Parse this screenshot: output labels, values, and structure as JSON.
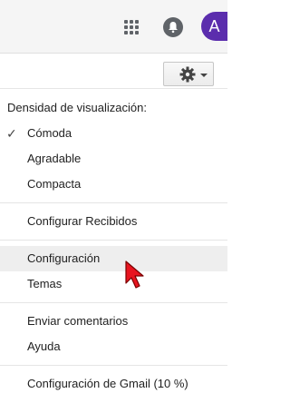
{
  "topbar": {
    "apps_icon": "apps-grid-icon",
    "notifications_icon": "bell-icon",
    "avatar_initial": "A",
    "avatar_color": "#5b2dad"
  },
  "settings_button": {
    "icon": "gear-icon",
    "caret": "chevron-down-icon"
  },
  "menu": {
    "density_header": "Densidad de visualización:",
    "density_options": [
      {
        "label": "Cómoda",
        "selected": true
      },
      {
        "label": "Agradable",
        "selected": false
      },
      {
        "label": "Compacta",
        "selected": false
      }
    ],
    "configure_inbox": "Configurar Recibidos",
    "settings": "Configuración",
    "themes": "Temas",
    "send_feedback": "Enviar comentarios",
    "help": "Ayuda",
    "gmail_setup": "Configuración de Gmail (10 %)",
    "check_glyph": "✓"
  }
}
